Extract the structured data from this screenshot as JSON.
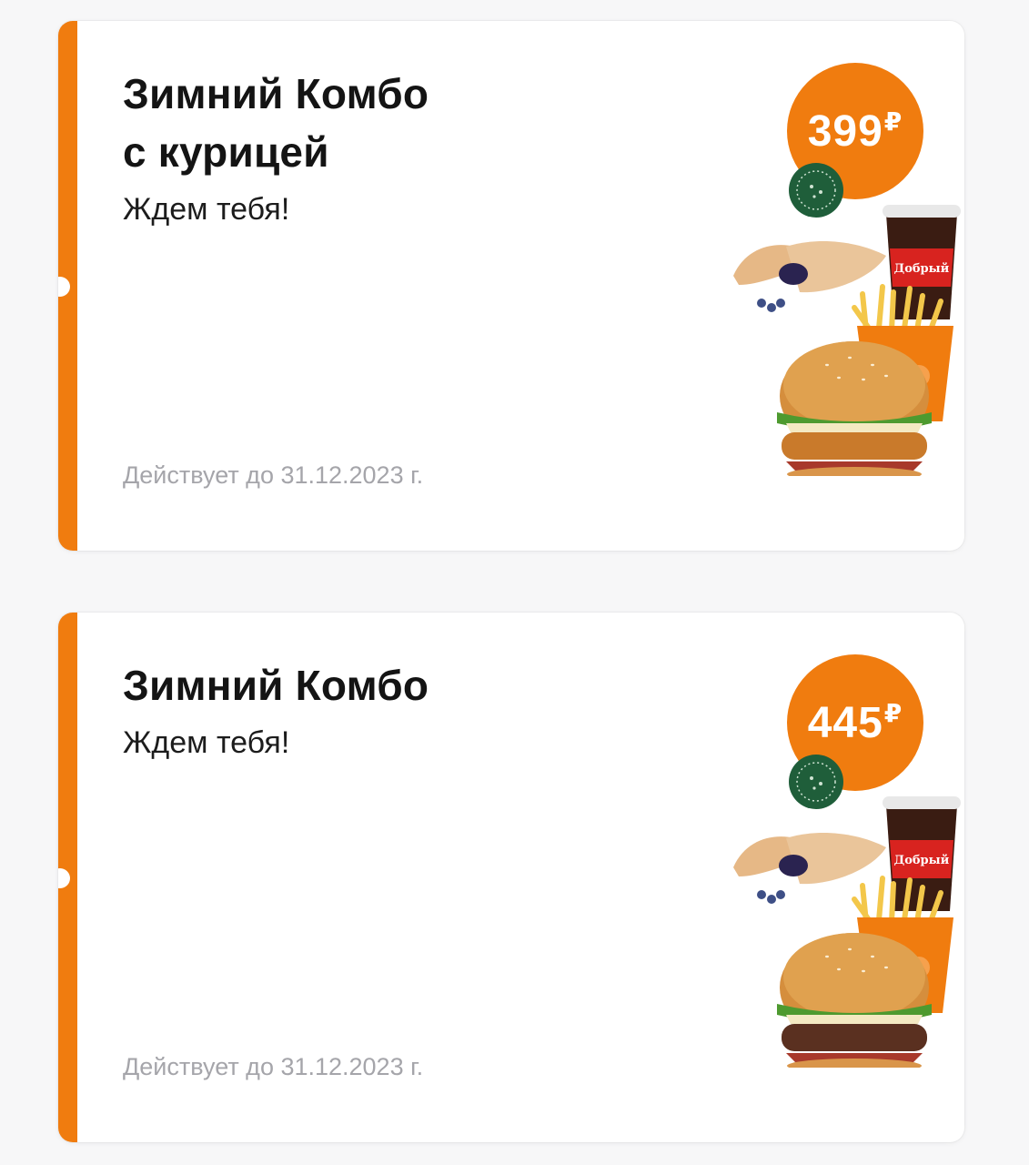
{
  "offers": [
    {
      "title_lines": [
        "Зимний Комбо",
        "с курицей"
      ],
      "subtitle": "Ждем тебя!",
      "price": "399",
      "currency": "₽",
      "validity": "Действует до 31.12.2023 г.",
      "drink_label": "Добрый",
      "burger_patty": "chicken"
    },
    {
      "title_lines": [
        "Зимний Комбо"
      ],
      "subtitle": "Ждем тебя!",
      "price": "445",
      "currency": "₽",
      "validity": "Действует до 31.12.2023 г.",
      "drink_label": "Добрый",
      "burger_patty": "beef"
    }
  ],
  "colors": {
    "accent": "#f07c0f",
    "title": "#141414",
    "muted": "#a5a5aa",
    "drink_red": "#d8231f",
    "badge_green": "#1f5e3a"
  }
}
